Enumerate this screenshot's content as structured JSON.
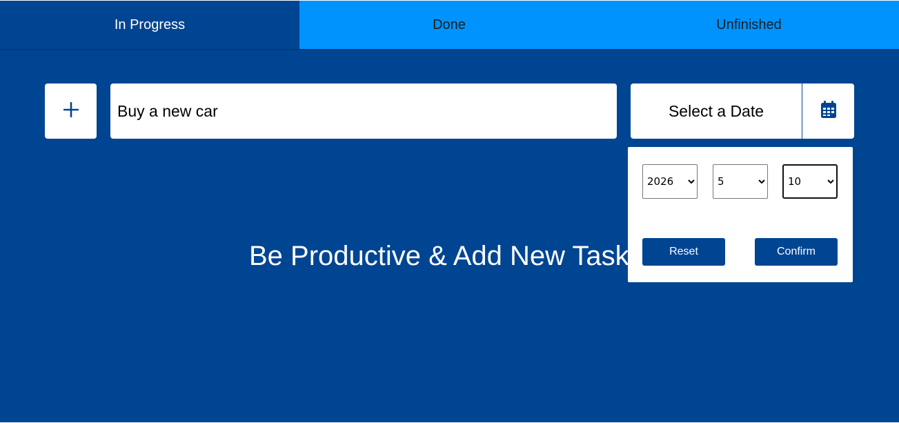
{
  "tabs": [
    {
      "label": "In Progress"
    },
    {
      "label": "Done"
    },
    {
      "label": "Unfinished"
    }
  ],
  "active_tab": "In Progress",
  "task_input": {
    "value": "Buy a new car"
  },
  "date_picker": {
    "label": "Select a Date",
    "calendar_icon": "calendar-icon",
    "year": {
      "selected": "2026",
      "options": [
        "2026"
      ]
    },
    "month": {
      "selected": "5",
      "options": [
        "5"
      ]
    },
    "day": {
      "selected": "10",
      "options": [
        "10"
      ]
    },
    "reset_label": "Reset",
    "confirm_label": "Confirm"
  },
  "add_button": {
    "icon": "plus-icon"
  },
  "empty_message": "Be Productive & Add New Tasks",
  "colors": {
    "background": "#004592",
    "tab_inactive": "#0093fd",
    "surface": "#ffffff",
    "accent": "#004592"
  }
}
